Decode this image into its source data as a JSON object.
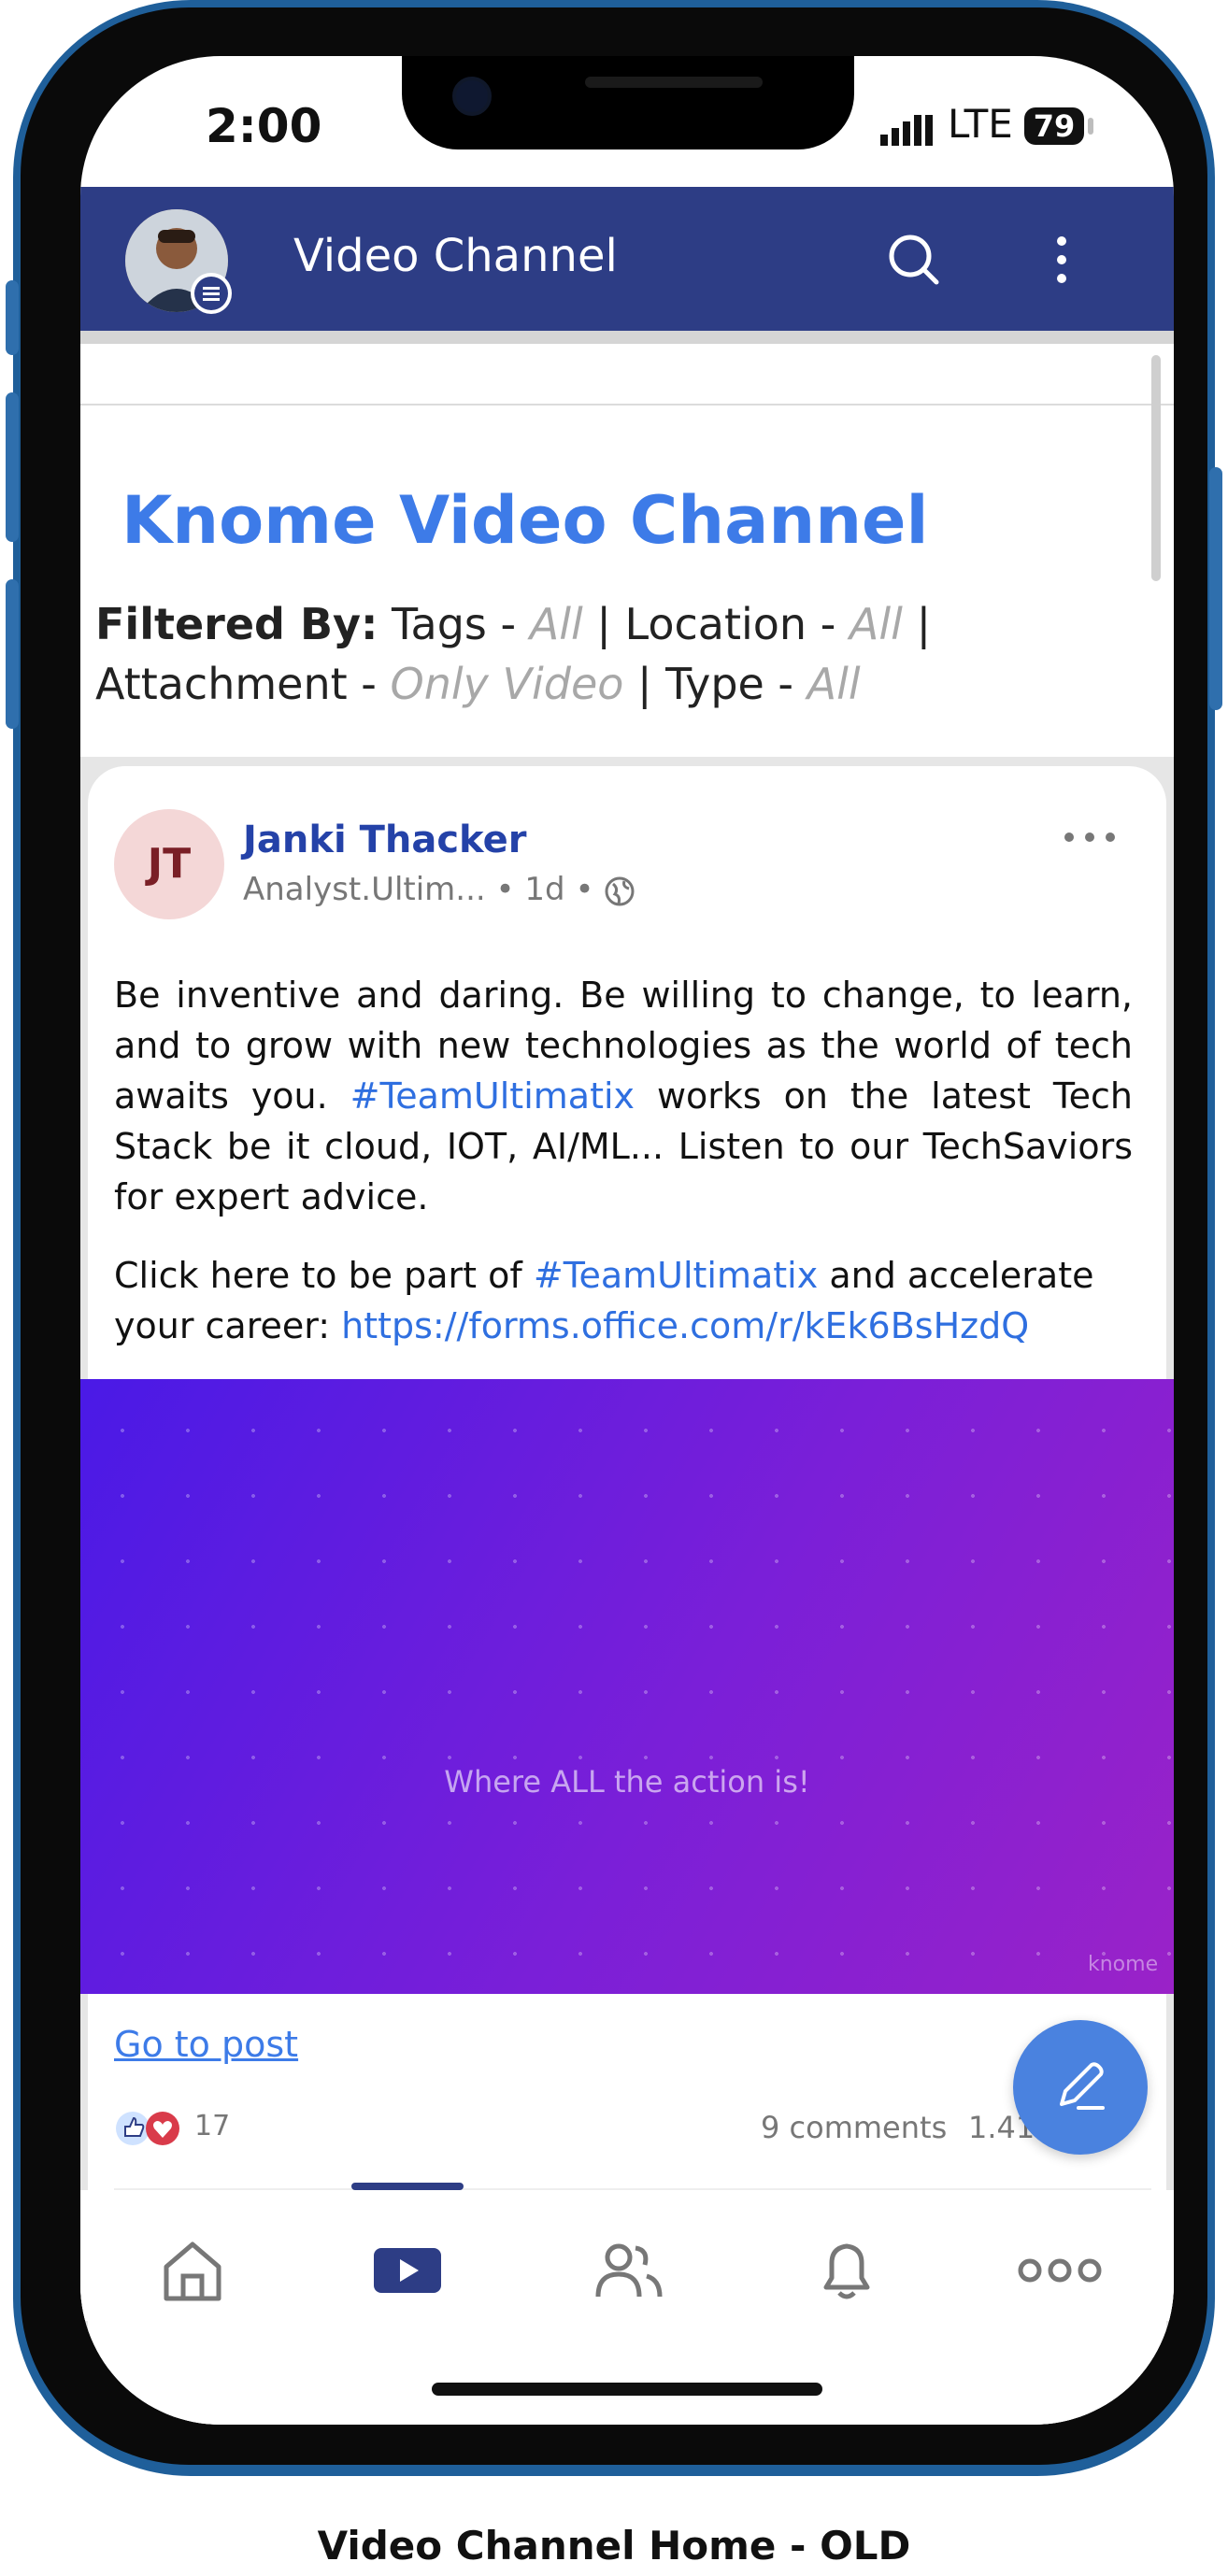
{
  "status_bar": {
    "time": "2:00",
    "network": "LTE",
    "battery": "79"
  },
  "app_bar": {
    "title": "Video Channel",
    "icons": [
      "avatar",
      "search-icon",
      "more-vertical-icon"
    ]
  },
  "channel": {
    "title": "Knome Video Channel",
    "filter": {
      "label": "Filtered By:",
      "tags_label": "Tags -",
      "tags_value": "All",
      "location_label": "Location -",
      "location_value": "All",
      "attachment_label": "Attachment -",
      "attachment_value": "Only Video",
      "type_label": "Type -",
      "type_value": "All",
      "sep": "|"
    }
  },
  "post": {
    "initials": "JT",
    "author": "Janki Thacker",
    "role": "Analyst.Ultim...",
    "age": "1d",
    "dot": "•",
    "body_p1_a": "Be inventive and daring. Be willing to change, to learn, and to grow with new technologies as the world of tech awaits you.",
    "hashtag": "#TeamUltimatix",
    "body_p1_b": "works on the latest Tech Stack be it cloud, IOT, AI/ML... Listen to our TechSaviors for expert advice.",
    "body_p2_a": "Click here to be part of",
    "body_p2_b": "and accelerate your career:",
    "link": "https://forms.office.com/r/kEk6BsHzdQ",
    "video_caption": "Where ALL the action is!",
    "video_watermark": "knome",
    "go_to_post": "Go to post",
    "reaction_count": "17",
    "comments": "9 comments",
    "views": "1.41k"
  },
  "bottom_nav": {
    "items": [
      "home-icon",
      "video-icon",
      "people-icon",
      "bell-icon",
      "more-horizontal-icon"
    ],
    "active": "video-icon"
  },
  "colors": {
    "appbar": "#2d3d85",
    "accent": "#3d7be8",
    "author": "#2442a8",
    "fab": "#4a82df"
  },
  "caption": "Video Channel Home - OLD"
}
